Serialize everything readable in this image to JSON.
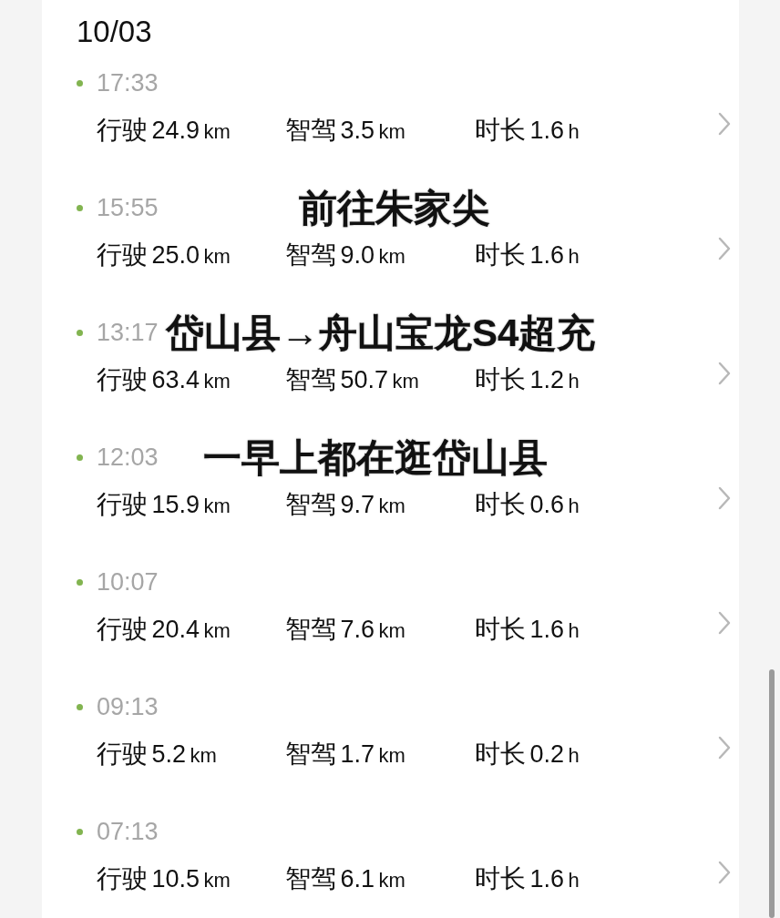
{
  "date": "10/03",
  "trips": [
    {
      "time": "17:33",
      "stats": [
        {
          "label": "行驶",
          "value": "24.9",
          "unit": "km"
        },
        {
          "label": "智驾",
          "value": "3.5",
          "unit": "km"
        },
        {
          "label": "时长",
          "value": "1.6",
          "unit": "h"
        }
      ]
    },
    {
      "time": "15:55",
      "caption": "前往朱家尖",
      "stats": [
        {
          "label": "行驶",
          "value": "25.0",
          "unit": "km"
        },
        {
          "label": "智驾",
          "value": "9.0",
          "unit": "km"
        },
        {
          "label": "时长",
          "value": "1.6",
          "unit": "h"
        }
      ]
    },
    {
      "time": "13:17",
      "caption": "岱山县→舟山宝龙S4超充",
      "stats": [
        {
          "label": "行驶",
          "value": "63.4",
          "unit": "km"
        },
        {
          "label": "智驾",
          "value": "50.7",
          "unit": "km"
        },
        {
          "label": "时长",
          "value": "1.2",
          "unit": "h"
        }
      ]
    },
    {
      "time": "12:03",
      "caption": "一早上都在逛岱山县",
      "stats": [
        {
          "label": "行驶",
          "value": "15.9",
          "unit": "km"
        },
        {
          "label": "智驾",
          "value": "9.7",
          "unit": "km"
        },
        {
          "label": "时长",
          "value": "0.6",
          "unit": "h"
        }
      ]
    },
    {
      "time": "10:07",
      "stats": [
        {
          "label": "行驶",
          "value": "20.4",
          "unit": "km"
        },
        {
          "label": "智驾",
          "value": "7.6",
          "unit": "km"
        },
        {
          "label": "时长",
          "value": "1.6",
          "unit": "h"
        }
      ]
    },
    {
      "time": "09:13",
      "stats": [
        {
          "label": "行驶",
          "value": "5.2",
          "unit": "km"
        },
        {
          "label": "智驾",
          "value": "1.7",
          "unit": "km"
        },
        {
          "label": "时长",
          "value": "0.2",
          "unit": "h"
        }
      ]
    },
    {
      "time": "07:13",
      "stats": [
        {
          "label": "行驶",
          "value": "10.5",
          "unit": "km"
        },
        {
          "label": "智驾",
          "value": "6.1",
          "unit": "km"
        },
        {
          "label": "时长",
          "value": "1.6",
          "unit": "h"
        }
      ]
    }
  ]
}
